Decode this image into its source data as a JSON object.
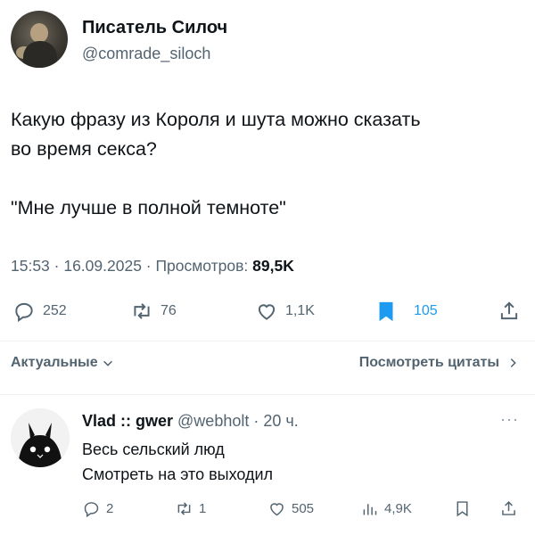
{
  "tweet": {
    "author_name": "Писатель Силоч",
    "author_handle": "@comrade_siloch",
    "text_line1": "Какую фразу из Короля и шута можно сказать",
    "text_line2": "во время секса?",
    "text_line3": "\"Мне лучше в полной темноте\"",
    "timestamp": "15:53 · 16.09.2025 · Просмотров: ",
    "views": "89,5K",
    "stats": {
      "replies": "252",
      "reposts": "76",
      "likes": "1,1K",
      "bookmarks": "105"
    }
  },
  "replies_section": {
    "sort_label": "Актуальные",
    "quotes_link": "Посмотреть цитаты"
  },
  "reply": {
    "author_name": "Vlad :: gwer",
    "author_handle": "@webholt",
    "time": "· 20 ч.",
    "more": "···",
    "line1": "Весь сельский люд",
    "line2": "Смотреть на это выходил",
    "stats": {
      "replies": "2",
      "reposts": "1",
      "likes": "505",
      "views": "4,9K"
    }
  },
  "colors": {
    "accent": "#1d9bf0",
    "secondary_text": "#536471",
    "text": "#0f1419"
  },
  "icons": [
    "reply-icon",
    "repost-icon",
    "like-icon",
    "bookmark-icon",
    "share-icon",
    "views-icon",
    "chevron-down-icon",
    "chevron-right-icon"
  ]
}
